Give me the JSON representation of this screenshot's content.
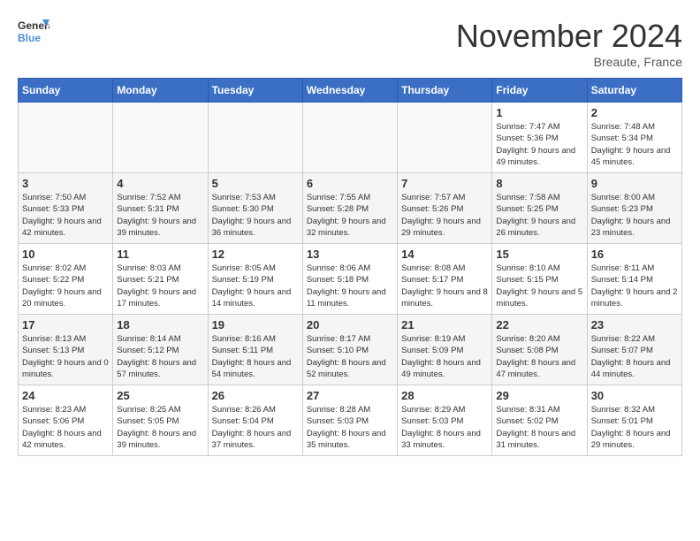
{
  "logo": {
    "line1": "General",
    "line2": "Blue"
  },
  "title": "November 2024",
  "location": "Breaute, France",
  "weekdays": [
    "Sunday",
    "Monday",
    "Tuesday",
    "Wednesday",
    "Thursday",
    "Friday",
    "Saturday"
  ],
  "rows": [
    [
      {
        "day": "",
        "info": ""
      },
      {
        "day": "",
        "info": ""
      },
      {
        "day": "",
        "info": ""
      },
      {
        "day": "",
        "info": ""
      },
      {
        "day": "",
        "info": ""
      },
      {
        "day": "1",
        "info": "Sunrise: 7:47 AM\nSunset: 5:36 PM\nDaylight: 9 hours and 49 minutes."
      },
      {
        "day": "2",
        "info": "Sunrise: 7:48 AM\nSunset: 5:34 PM\nDaylight: 9 hours and 45 minutes."
      }
    ],
    [
      {
        "day": "3",
        "info": "Sunrise: 7:50 AM\nSunset: 5:33 PM\nDaylight: 9 hours and 42 minutes."
      },
      {
        "day": "4",
        "info": "Sunrise: 7:52 AM\nSunset: 5:31 PM\nDaylight: 9 hours and 39 minutes."
      },
      {
        "day": "5",
        "info": "Sunrise: 7:53 AM\nSunset: 5:30 PM\nDaylight: 9 hours and 36 minutes."
      },
      {
        "day": "6",
        "info": "Sunrise: 7:55 AM\nSunset: 5:28 PM\nDaylight: 9 hours and 32 minutes."
      },
      {
        "day": "7",
        "info": "Sunrise: 7:57 AM\nSunset: 5:26 PM\nDaylight: 9 hours and 29 minutes."
      },
      {
        "day": "8",
        "info": "Sunrise: 7:58 AM\nSunset: 5:25 PM\nDaylight: 9 hours and 26 minutes."
      },
      {
        "day": "9",
        "info": "Sunrise: 8:00 AM\nSunset: 5:23 PM\nDaylight: 9 hours and 23 minutes."
      }
    ],
    [
      {
        "day": "10",
        "info": "Sunrise: 8:02 AM\nSunset: 5:22 PM\nDaylight: 9 hours and 20 minutes."
      },
      {
        "day": "11",
        "info": "Sunrise: 8:03 AM\nSunset: 5:21 PM\nDaylight: 9 hours and 17 minutes."
      },
      {
        "day": "12",
        "info": "Sunrise: 8:05 AM\nSunset: 5:19 PM\nDaylight: 9 hours and 14 minutes."
      },
      {
        "day": "13",
        "info": "Sunrise: 8:06 AM\nSunset: 5:18 PM\nDaylight: 9 hours and 11 minutes."
      },
      {
        "day": "14",
        "info": "Sunrise: 8:08 AM\nSunset: 5:17 PM\nDaylight: 9 hours and 8 minutes."
      },
      {
        "day": "15",
        "info": "Sunrise: 8:10 AM\nSunset: 5:15 PM\nDaylight: 9 hours and 5 minutes."
      },
      {
        "day": "16",
        "info": "Sunrise: 8:11 AM\nSunset: 5:14 PM\nDaylight: 9 hours and 2 minutes."
      }
    ],
    [
      {
        "day": "17",
        "info": "Sunrise: 8:13 AM\nSunset: 5:13 PM\nDaylight: 9 hours and 0 minutes."
      },
      {
        "day": "18",
        "info": "Sunrise: 8:14 AM\nSunset: 5:12 PM\nDaylight: 8 hours and 57 minutes."
      },
      {
        "day": "19",
        "info": "Sunrise: 8:16 AM\nSunset: 5:11 PM\nDaylight: 8 hours and 54 minutes."
      },
      {
        "day": "20",
        "info": "Sunrise: 8:17 AM\nSunset: 5:10 PM\nDaylight: 8 hours and 52 minutes."
      },
      {
        "day": "21",
        "info": "Sunrise: 8:19 AM\nSunset: 5:09 PM\nDaylight: 8 hours and 49 minutes."
      },
      {
        "day": "22",
        "info": "Sunrise: 8:20 AM\nSunset: 5:08 PM\nDaylight: 8 hours and 47 minutes."
      },
      {
        "day": "23",
        "info": "Sunrise: 8:22 AM\nSunset: 5:07 PM\nDaylight: 8 hours and 44 minutes."
      }
    ],
    [
      {
        "day": "24",
        "info": "Sunrise: 8:23 AM\nSunset: 5:06 PM\nDaylight: 8 hours and 42 minutes."
      },
      {
        "day": "25",
        "info": "Sunrise: 8:25 AM\nSunset: 5:05 PM\nDaylight: 8 hours and 39 minutes."
      },
      {
        "day": "26",
        "info": "Sunrise: 8:26 AM\nSunset: 5:04 PM\nDaylight: 8 hours and 37 minutes."
      },
      {
        "day": "27",
        "info": "Sunrise: 8:28 AM\nSunset: 5:03 PM\nDaylight: 8 hours and 35 minutes."
      },
      {
        "day": "28",
        "info": "Sunrise: 8:29 AM\nSunset: 5:03 PM\nDaylight: 8 hours and 33 minutes."
      },
      {
        "day": "29",
        "info": "Sunrise: 8:31 AM\nSunset: 5:02 PM\nDaylight: 8 hours and 31 minutes."
      },
      {
        "day": "30",
        "info": "Sunrise: 8:32 AM\nSunset: 5:01 PM\nDaylight: 8 hours and 29 minutes."
      }
    ]
  ]
}
